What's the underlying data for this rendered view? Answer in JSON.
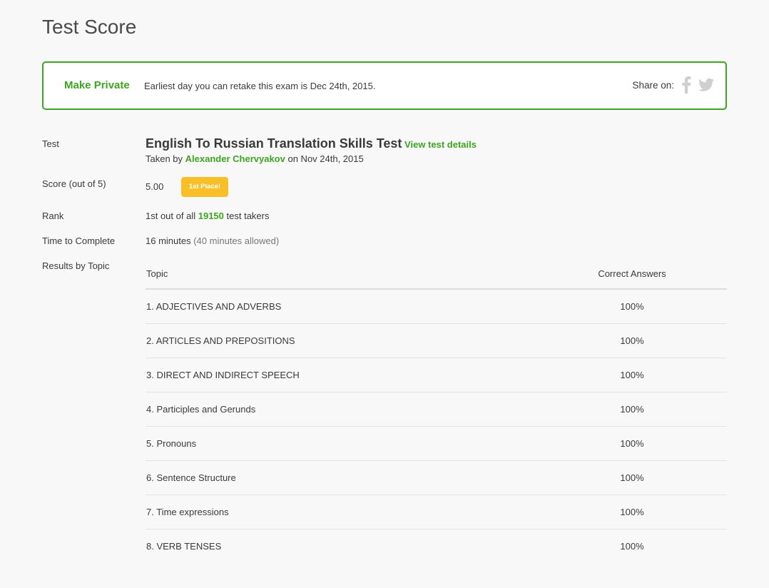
{
  "page": {
    "title": "Test Score"
  },
  "banner": {
    "make_private_label": "Make Private",
    "retake_note": "Earliest day you can retake this exam is Dec 24th, 2015.",
    "share_label": "Share on:",
    "icons": [
      "facebook-icon",
      "twitter-icon"
    ]
  },
  "details": {
    "test_label": "Test",
    "test_name": "English To Russian Translation Skills Test",
    "view_details_label": "View test details",
    "taken_by_prefix": "Taken by",
    "taker_name": "Alexander Chervyakov",
    "taken_on_text": "on Nov 24th, 2015",
    "score_label": "Score (out of 5)",
    "score_value": "5.00",
    "badge": "1st Place!",
    "rank_label": "Rank",
    "rank_prefix": "1st out of all",
    "rank_count": "19150",
    "rank_suffix": "test takers",
    "time_label": "Time to Complete",
    "time_value": "16 minutes",
    "time_allowed": "(40 minutes allowed)",
    "results_label": "Results by Topic"
  },
  "topics": {
    "headers": {
      "topic": "Topic",
      "answers": "Correct Answers"
    },
    "rows": [
      {
        "topic": "1. ADJECTIVES AND ADVERBS",
        "answers": "100%"
      },
      {
        "topic": "2. ARTICLES AND PREPOSITIONS",
        "answers": "100%"
      },
      {
        "topic": "3. DIRECT AND INDIRECT SPEECH",
        "answers": "100%"
      },
      {
        "topic": "4. Participles and Gerunds",
        "answers": "100%"
      },
      {
        "topic": "5. Pronouns",
        "answers": "100%"
      },
      {
        "topic": "6. Sentence Structure",
        "answers": "100%"
      },
      {
        "topic": "7. Time expressions",
        "answers": "100%"
      },
      {
        "topic": "8. VERB TENSES",
        "answers": "100%"
      }
    ]
  },
  "colors": {
    "accent": "#3da520",
    "badge": "#f9bf27",
    "background": "#f8f8f8"
  }
}
